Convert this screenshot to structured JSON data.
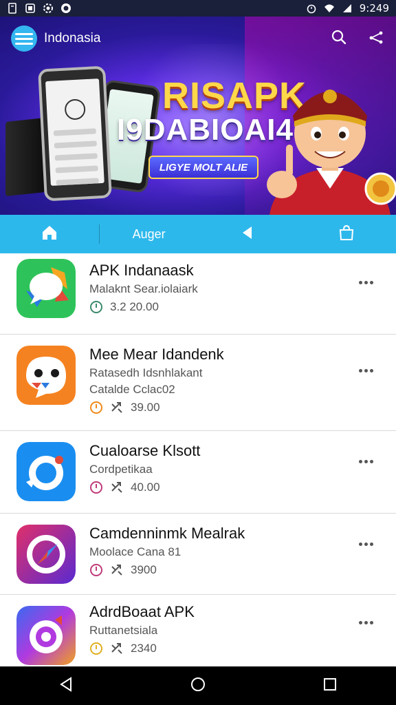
{
  "status_bar": {
    "time": "9:249",
    "left_icons": [
      "file-icon",
      "storage-icon",
      "settings-icon",
      "circle-icon"
    ],
    "right_icons": [
      "alarm-icon",
      "wifi-icon",
      "signal-icon"
    ]
  },
  "header": {
    "brand_name": "Indonasia",
    "actions": [
      "search-icon",
      "share-icon"
    ]
  },
  "banner": {
    "title": "RISAPK",
    "subtitle": "I9DABIOAI4",
    "button_label": "LIGYE MOLT ALIE"
  },
  "tabs": {
    "home_icon": "home-icon",
    "center_label": "Auger",
    "back_icon": "back-arrow-icon",
    "bag_icon": "bag-icon"
  },
  "apps": [
    {
      "title": "APK Indanaask",
      "subtitle": "Malaknt Sear.iolaiark",
      "subtitle2": "",
      "meta": "3.2 20.00",
      "clock_color": "#3a8a6a",
      "icon": "chat-bubble-icon",
      "icon_bg": "#2ec35a"
    },
    {
      "title": "Mee Mear Idandenk",
      "subtitle": "Ratasedh Idsnhlakant",
      "subtitle2": "Catalde Cclac02",
      "meta": "39.00",
      "clock_color": "#f08a1a",
      "icon": "face-chat-icon",
      "icon_bg": "#f58220"
    },
    {
      "title": "Cualoarse Klsott",
      "subtitle": "Cordpetikaa",
      "subtitle2": "",
      "meta": "40.00",
      "clock_color": "#c03a7a",
      "icon": "link-ring-icon",
      "icon_bg": "#1a8ef0"
    },
    {
      "title": "Camdenninmk Mealrak",
      "subtitle": "Moolace Cana 81",
      "subtitle2": "",
      "meta": "3900",
      "clock_color": "#c03a7a",
      "icon": "compass-icon",
      "icon_bg": "#7a2ad0"
    },
    {
      "title": "AdrdBoaat APK",
      "subtitle": "Ruttanetsiala",
      "subtitle2": "",
      "meta": "2340",
      "clock_color": "#e0b020",
      "icon": "target-ring-icon",
      "icon_bg": "#b03ae0"
    }
  ],
  "nav": {
    "back": "nav-back-icon",
    "home": "nav-home-icon",
    "recents": "nav-recents-icon"
  }
}
